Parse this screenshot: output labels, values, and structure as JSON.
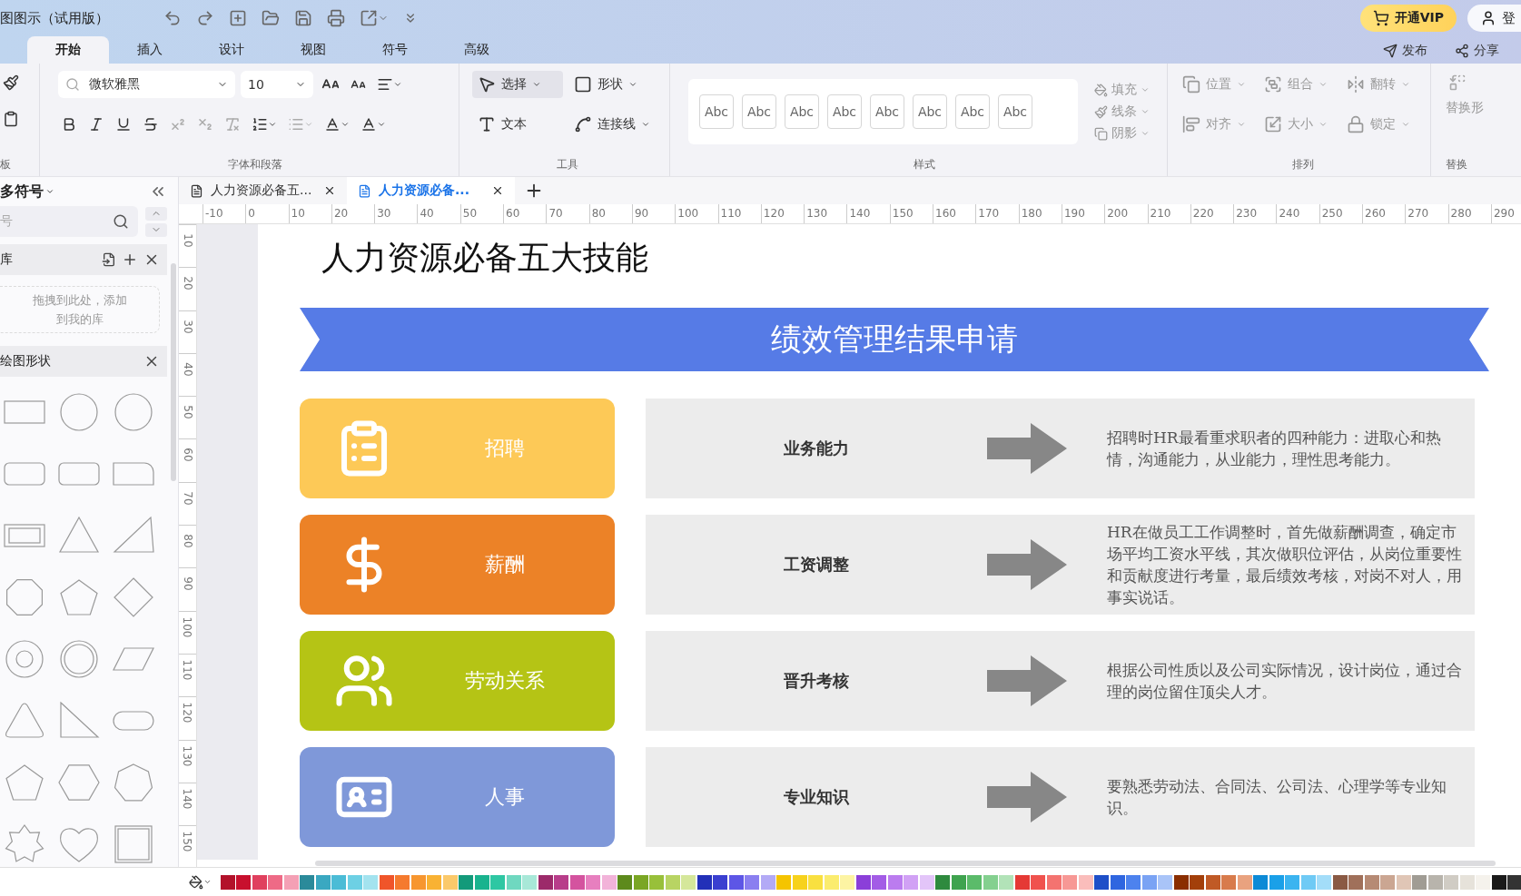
{
  "app": {
    "title": "图图示（试用版）",
    "vip_button": "开通VIP",
    "login": "登",
    "publish": "发布",
    "share": "分享"
  },
  "menu_tabs": [
    {
      "label": "开始",
      "selected": true
    },
    {
      "label": "插入",
      "selected": false
    },
    {
      "label": "设计",
      "selected": false
    },
    {
      "label": "视图",
      "selected": false
    },
    {
      "label": "符号",
      "selected": false
    },
    {
      "label": "高级",
      "selected": false
    }
  ],
  "ribbon": {
    "clipboard_label": "板",
    "font_name": "微软雅黑",
    "font_size": "10",
    "font_group_label": "字体和段落",
    "tools": [
      {
        "label": "选择",
        "selected": true
      },
      {
        "label": "形状",
        "selected": false
      },
      {
        "label": "文本",
        "selected": false
      },
      {
        "label": "连接线",
        "selected": false
      }
    ],
    "tools_label": "工具",
    "style_swatches": [
      "Abc",
      "Abc",
      "Abc",
      "Abc",
      "Abc",
      "Abc",
      "Abc",
      "Abc"
    ],
    "styles_label": "样式",
    "format": [
      "填充",
      "线条",
      "阴影"
    ],
    "arrange": [
      "位置",
      "组合",
      "翻转",
      "对齐",
      "大小",
      "锁定"
    ],
    "arrange_label": "排列",
    "replace": "替换形",
    "replace_label": "替换"
  },
  "sidebar": {
    "title": "多符号",
    "search_placeholder": "号",
    "library_title": "库",
    "drop_hint": "拖拽到此处，添加到我的库",
    "shapes_title": "绘图形状"
  },
  "doc_tabs": [
    {
      "label": "人力资源必备五...",
      "selected": false
    },
    {
      "label": "人力资源必备...",
      "selected": true
    }
  ],
  "ruler": {
    "horizontal": [
      "-10",
      "0",
      "10",
      "20",
      "30",
      "40",
      "50",
      "60",
      "70",
      "80",
      "90",
      "100",
      "110",
      "120",
      "130",
      "140",
      "150",
      "160",
      "170",
      "180",
      "190",
      "200",
      "210",
      "220",
      "230",
      "240",
      "250",
      "260",
      "270",
      "280",
      "290"
    ],
    "vertical": [
      "10",
      "20",
      "30",
      "40",
      "50",
      "60",
      "70",
      "80",
      "90",
      "100",
      "110",
      "120",
      "130",
      "140",
      "150"
    ]
  },
  "diagram": {
    "title": "人力资源必备五大技能",
    "banner": "绩效管理结果申请",
    "rows": [
      {
        "category": "招聘",
        "color": "#fdc957",
        "skill": "业务能力",
        "description": "招聘时HR最看重求职者的四种能力：进取心和热情，沟通能力，从业能力，理性思考能力。"
      },
      {
        "category": "薪酬",
        "color": "#ec8227",
        "skill": "工资调整",
        "description": "HR在做员工工作调整时，首先做薪酬调查，确定市场平均工资水平线，其次做职位评估，从岗位重要性和贡献度进行考量，最后绩效考核，对岗不对人，用事实说话。"
      },
      {
        "category": "劳动关系",
        "color": "#b5c415",
        "skill": "晋升考核",
        "description": "根据公司性质以及公司实际情况，设计岗位，通过合理的岗位留住顶尖人才。"
      },
      {
        "category": "人事",
        "color": "#7f98d9",
        "skill": "专业知识",
        "description": "要熟悉劳动法、合同法、公司法、心理学等专业知识。"
      }
    ]
  },
  "palette": [
    {
      "color": "#b3122a"
    },
    {
      "color": "#c8102e"
    },
    {
      "color": "#e0405e"
    },
    {
      "color": "#ee6a86"
    },
    {
      "color": "#f4a0b5"
    },
    {
      "color": "#2b8a9a"
    },
    {
      "color": "#3aa8c1"
    },
    {
      "color": "#4bbcd6"
    },
    {
      "color": "#6dd0e4"
    },
    {
      "color": "#a3e3ef"
    },
    {
      "color": "#f0552a"
    },
    {
      "color": "#f57a2e"
    },
    {
      "color": "#f7962f"
    },
    {
      "color": "#f9b233"
    },
    {
      "color": "#fbc96a"
    },
    {
      "color": "#139a7a"
    },
    {
      "color": "#19b38e"
    },
    {
      "color": "#2ec7a3"
    },
    {
      "color": "#6fd8c0"
    },
    {
      "color": "#a8e8d8"
    },
    {
      "color": "#9c2a6a"
    },
    {
      "color": "#b83d8a"
    },
    {
      "color": "#d4539f"
    },
    {
      "color": "#e77fbf"
    },
    {
      "color": "#f2b3d9"
    },
    {
      "color": "#5d8a1c"
    },
    {
      "color": "#7aa624"
    },
    {
      "color": "#98c03a"
    },
    {
      "color": "#b8d463"
    },
    {
      "color": "#d5e79a"
    },
    {
      "color": "#2230b8"
    },
    {
      "color": "#3a3fd0"
    },
    {
      "color": "#5d56e6"
    },
    {
      "color": "#8a7ff0"
    },
    {
      "color": "#b3aaf6"
    },
    {
      "color": "#f5c400"
    },
    {
      "color": "#f7d21c"
    },
    {
      "color": "#f9e040"
    },
    {
      "color": "#fbec6e"
    },
    {
      "color": "#fdf4a3"
    },
    {
      "color": "#8b3fd9"
    },
    {
      "color": "#a35ce6"
    },
    {
      "color": "#bb7cef"
    },
    {
      "color": "#d1a1f5"
    },
    {
      "color": "#e3c5f9"
    },
    {
      "color": "#2e8a3e"
    },
    {
      "color": "#3fa34f"
    },
    {
      "color": "#5bbb6a"
    },
    {
      "color": "#84d08f"
    },
    {
      "color": "#b2e3b8"
    },
    {
      "color": "#e53935"
    },
    {
      "color": "#f0524e"
    },
    {
      "color": "#f47370"
    },
    {
      "color": "#f79895"
    },
    {
      "color": "#fabdbb"
    },
    {
      "color": "#1e4fc8"
    },
    {
      "color": "#2f66e0"
    },
    {
      "color": "#4d82ee"
    },
    {
      "color": "#7aa3f4"
    },
    {
      "color": "#a9c4f8"
    },
    {
      "color": "#8a2e00"
    },
    {
      "color": "#a33f0a"
    },
    {
      "color": "#c05a26"
    },
    {
      "color": "#d87b4c"
    },
    {
      "color": "#e9a27f"
    },
    {
      "color": "#0c8ad6"
    },
    {
      "color": "#1aa0e8"
    },
    {
      "color": "#3bb4f0"
    },
    {
      "color": "#6fcaf5"
    },
    {
      "color": "#a3ddf9"
    },
    {
      "color": "#8a5a44"
    },
    {
      "color": "#a0705a"
    },
    {
      "color": "#b68a74"
    },
    {
      "color": "#cba692"
    },
    {
      "color": "#e0c6b6"
    },
    {
      "color": "#a09c94"
    },
    {
      "color": "#b8b4ac"
    },
    {
      "color": "#d0ccc4"
    },
    {
      "color": "#e6e2da"
    },
    {
      "color": "#f5f2ec"
    },
    {
      "color": "#1a1a1a"
    },
    {
      "color": "#333333"
    }
  ]
}
